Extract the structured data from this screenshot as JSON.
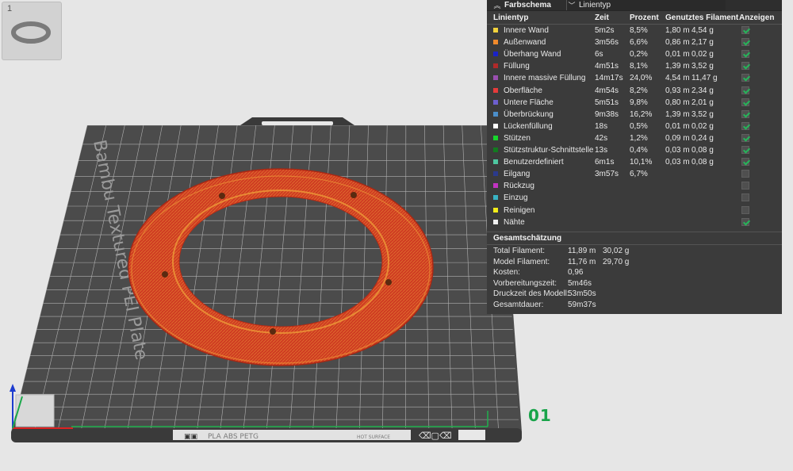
{
  "thumbnail": {
    "number": "1"
  },
  "plate": {
    "label": "Bambu Textured PEI Plate",
    "filaments": "PLA ABS PETG",
    "surface": "HOT SURFACE",
    "plate_id": "01"
  },
  "panel": {
    "title": "Farbschema",
    "scheme_value": "Linientyp",
    "headers": {
      "type": "Linientyp",
      "time": "Zeit",
      "percent": "Prozent",
      "filament": "Genutztes Filament",
      "show": "Anzeigen"
    },
    "rows": [
      {
        "label": "Innere Wand",
        "color": "#f2d23c",
        "time": "5m2s",
        "percent": "8,5%",
        "length": "1,80 m",
        "weight": "4,54 g",
        "shown": true
      },
      {
        "label": "Außenwand",
        "color": "#f08a2c",
        "time": "3m56s",
        "percent": "6,6%",
        "length": "0,86 m",
        "weight": "2,17 g",
        "shown": true
      },
      {
        "label": "Überhang Wand",
        "color": "#1a22c8",
        "time": "6s",
        "percent": "0,2%",
        "length": "0,01 m",
        "weight": "0,02 g",
        "shown": true
      },
      {
        "label": "Füllung",
        "color": "#b02a2a",
        "time": "4m51s",
        "percent": "8,1%",
        "length": "1,39 m",
        "weight": "3,52 g",
        "shown": true
      },
      {
        "label": "Innere massive Füllung",
        "color": "#9a4fb0",
        "time": "14m17s",
        "percent": "24,0%",
        "length": "4,54 m",
        "weight": "11,47 g",
        "shown": true
      },
      {
        "label": "Oberfläche",
        "color": "#e63b3b",
        "time": "4m54s",
        "percent": "8,2%",
        "length": "0,93 m",
        "weight": "2,34 g",
        "shown": true
      },
      {
        "label": "Untere Fläche",
        "color": "#6d5fcf",
        "time": "5m51s",
        "percent": "9,8%",
        "length": "0,80 m",
        "weight": "2,01 g",
        "shown": true
      },
      {
        "label": "Überbrückung",
        "color": "#4b8ec9",
        "time": "9m38s",
        "percent": "16,2%",
        "length": "1,39 m",
        "weight": "3,52 g",
        "shown": true
      },
      {
        "label": "Lückenfüllung",
        "color": "#ffffff",
        "time": "18s",
        "percent": "0,5%",
        "length": "0,01 m",
        "weight": "0,02 g",
        "shown": true
      },
      {
        "label": "Stützen",
        "color": "#17d62c",
        "time": "42s",
        "percent": "1,2%",
        "length": "0,09 m",
        "weight": "0,24 g",
        "shown": true
      },
      {
        "label": "Stützstruktur-Schnittstelle",
        "color": "#127a1f",
        "time": "13s",
        "percent": "0,4%",
        "length": "0,03 m",
        "weight": "0,08 g",
        "shown": true
      },
      {
        "label": "Benutzerdefiniert",
        "color": "#4ec7a0",
        "time": "6m1s",
        "percent": "10,1%",
        "length": "0,03 m",
        "weight": "0,08 g",
        "shown": true
      },
      {
        "label": "Eilgang",
        "color": "#2b3a8c",
        "time": "3m57s",
        "percent": "6,7%",
        "length": "",
        "weight": "",
        "shown": false
      },
      {
        "label": "Rückzug",
        "color": "#c233c2",
        "time": "",
        "percent": "",
        "length": "",
        "weight": "",
        "shown": false
      },
      {
        "label": "Einzug",
        "color": "#38b3c4",
        "time": "",
        "percent": "",
        "length": "",
        "weight": "",
        "shown": false
      },
      {
        "label": "Reinigen",
        "color": "#f2ec1a",
        "time": "",
        "percent": "",
        "length": "",
        "weight": "",
        "shown": false
      },
      {
        "label": "Nähte",
        "color": "#f0f0f0",
        "time": "",
        "percent": "",
        "length": "",
        "weight": "",
        "shown": true
      }
    ],
    "summary_title": "Gesamtschätzung",
    "summary": [
      {
        "label": "Total Filament:",
        "v1": "11,89 m",
        "v2": "30,02 g"
      },
      {
        "label": "Model Filament:",
        "v1": "11,76 m",
        "v2": "29,70 g"
      },
      {
        "label": "Kosten:",
        "v1": "0,96",
        "v2": ""
      },
      {
        "label": "Vorbereitungszeit:",
        "v1": "5m46s",
        "v2": ""
      },
      {
        "label": "Druckzeit des Modell:",
        "v1": "53m50s",
        "v2": ""
      },
      {
        "label": "Gesamtdauer:",
        "v1": "59m37s",
        "v2": ""
      }
    ]
  }
}
